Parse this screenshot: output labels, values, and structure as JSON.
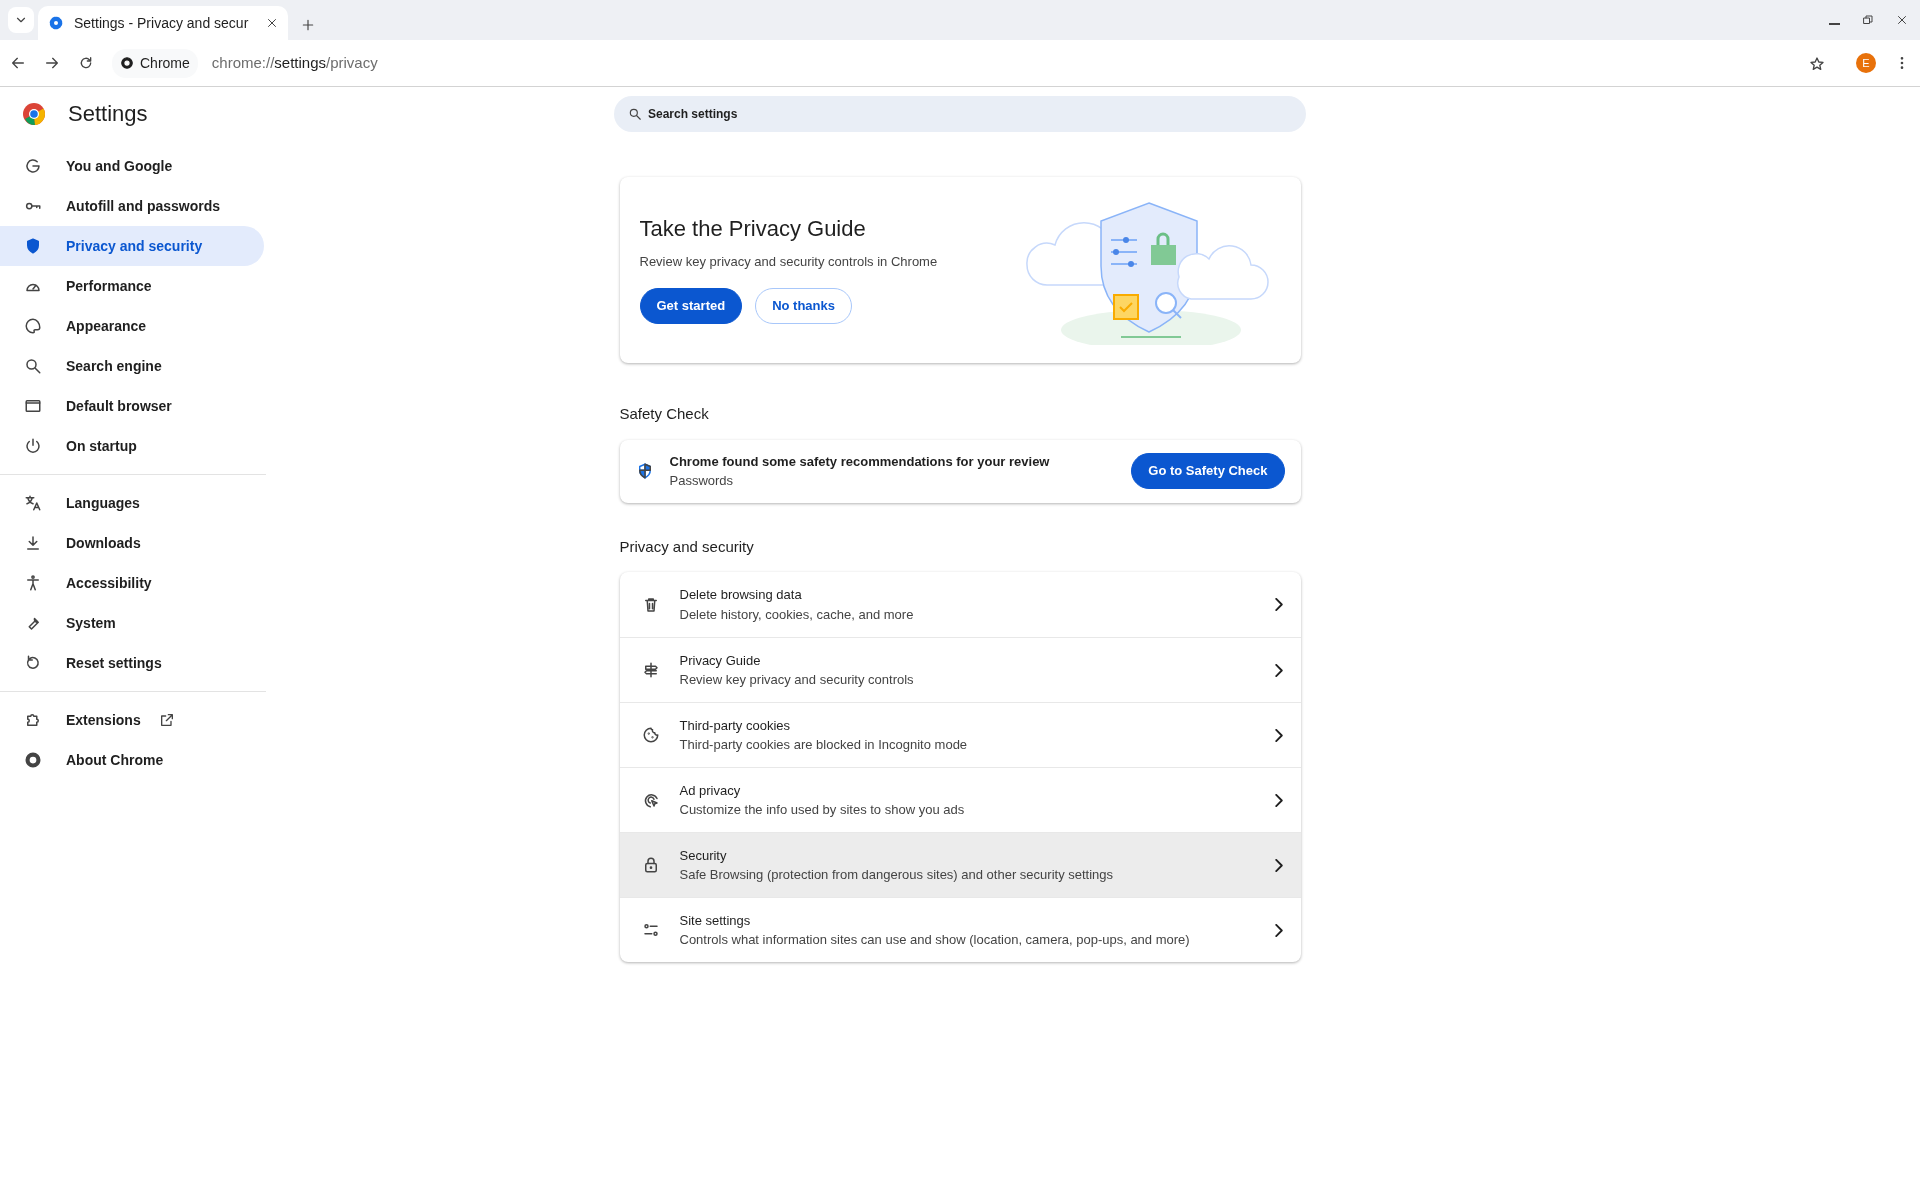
{
  "browser": {
    "tabs": [
      {
        "title": "Settings - Privacy and secur",
        "selected": true
      }
    ],
    "omnibox": {
      "chip": "Chrome",
      "url_scheme": "chrome://",
      "url_host": "settings",
      "url_path": "/privacy"
    },
    "profile_initial": "E"
  },
  "sidebar": {
    "title": "Settings",
    "groups": [
      {
        "items": [
          {
            "label": "You and Google",
            "selected": false
          },
          {
            "label": "Autofill and passwords",
            "selected": false
          },
          {
            "label": "Privacy and security",
            "selected": true
          },
          {
            "label": "Performance",
            "selected": false
          },
          {
            "label": "Appearance",
            "selected": false
          },
          {
            "label": "Search engine",
            "selected": false
          },
          {
            "label": "Default browser",
            "selected": false
          },
          {
            "label": "On startup",
            "selected": false
          }
        ]
      },
      {
        "items": [
          {
            "label": "Languages",
            "selected": false
          },
          {
            "label": "Downloads",
            "selected": false
          },
          {
            "label": "Accessibility",
            "selected": false
          },
          {
            "label": "System",
            "selected": false
          },
          {
            "label": "Reset settings",
            "selected": false
          }
        ]
      },
      {
        "items": [
          {
            "label": "Extensions",
            "selected": false,
            "external": true
          },
          {
            "label": "About Chrome",
            "selected": false
          }
        ]
      }
    ]
  },
  "search": {
    "placeholder": "Search settings"
  },
  "privacy_guide_card": {
    "title": "Take the Privacy Guide",
    "description": "Review key privacy and security controls in Chrome",
    "buttons": [
      {
        "label": "Get started",
        "kind": "primary"
      },
      {
        "label": "No thanks",
        "kind": "outline"
      }
    ]
  },
  "safety_check": {
    "heading": "Safety Check",
    "message": "Chrome found some safety recommendations for your review",
    "detail": "Passwords",
    "button": "Go to Safety Check"
  },
  "privacy_section": {
    "heading": "Privacy and security",
    "rows": [
      {
        "title": "Delete browsing data",
        "subtitle": "Delete history, cookies, cache, and more",
        "hovered": false
      },
      {
        "title": "Privacy Guide",
        "subtitle": "Review key privacy and security controls",
        "hovered": false
      },
      {
        "title": "Third-party cookies",
        "subtitle": "Third-party cookies are blocked in Incognito mode",
        "hovered": false
      },
      {
        "title": "Ad privacy",
        "subtitle": "Customize the info used by sites to show you ads",
        "hovered": false
      },
      {
        "title": "Security",
        "subtitle": "Safe Browsing (protection from dangerous sites) and other security settings",
        "hovered": true
      },
      {
        "title": "Site settings",
        "subtitle": "Controls what information sites can use and show (location, camera, pop-ups, and more)",
        "hovered": false
      }
    ]
  }
}
